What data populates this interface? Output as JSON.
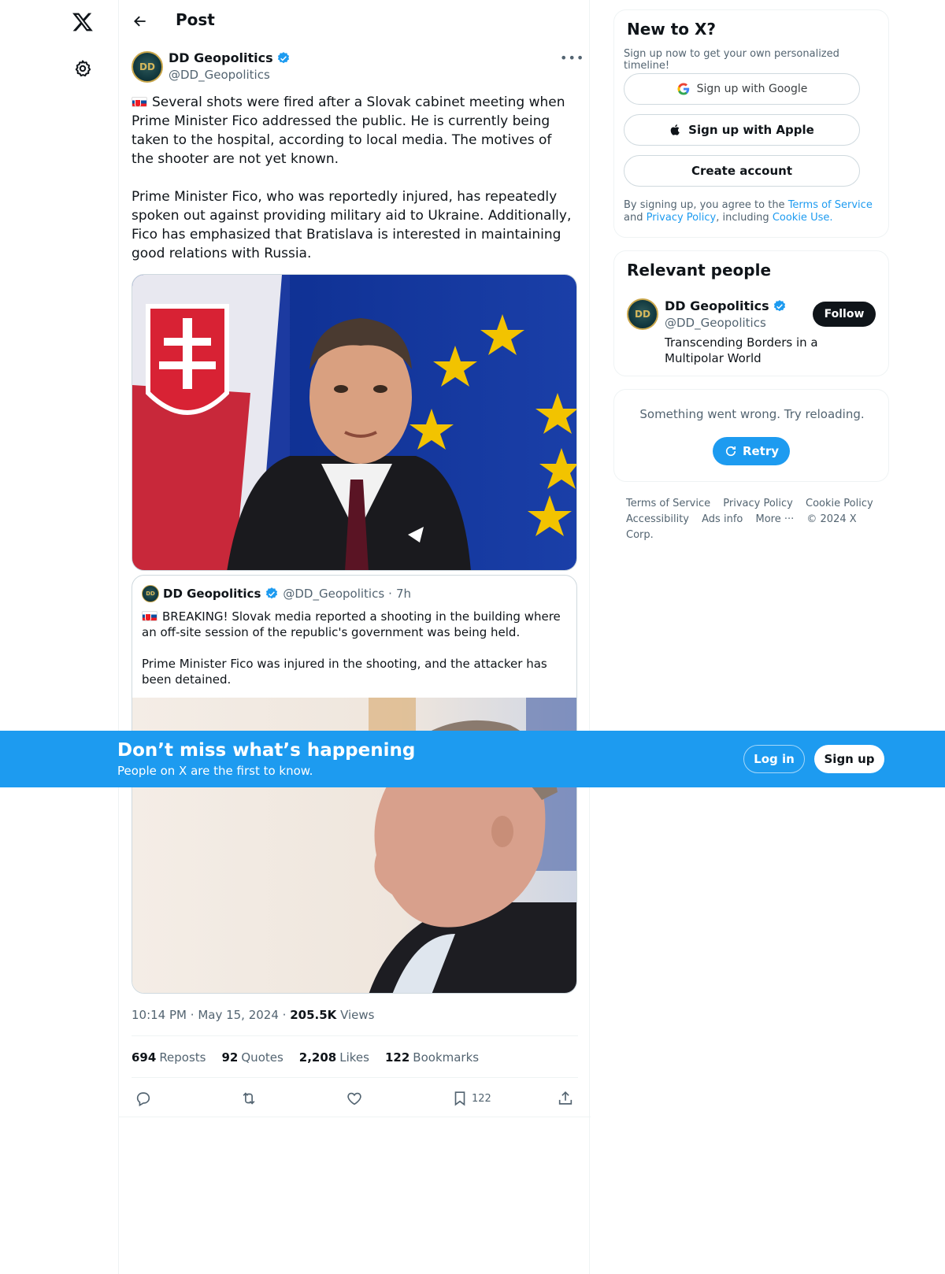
{
  "header": {
    "title": "Post"
  },
  "post": {
    "author": {
      "name": "DD Geopolitics",
      "handle": "@DD_Geopolitics",
      "avatar_text": "DD"
    },
    "paragraphs": [
      "Several shots were fired after a Slovak cabinet meeting when Prime Minister Fico addressed the public. He is currently being taken to the hospital, according to local media. The motives of the shooter are not yet known.",
      "Prime Minister Fico, who was reportedly injured, has repeatedly spoken out against providing military aid to Ukraine. Additionally, Fico has emphasized that Bratislava is interested in maintaining good relations with Russia."
    ],
    "quote": {
      "name": "DD Geopolitics",
      "handle": "@DD_Geopolitics",
      "time": "7h",
      "paragraphs": [
        "BREAKING! Slovak media reported a shooting in the building where an off-site session of the republic's government was being held.",
        "Prime Minister Fico was injured in the shooting, and the attacker has been detained."
      ]
    },
    "time": "10:14 PM",
    "date": "May 15, 2024",
    "views_count": "205.5K",
    "views_label": "Views",
    "stats": {
      "reposts": "694",
      "reposts_label": "Reposts",
      "quotes": "92",
      "quotes_label": "Quotes",
      "likes": "2,208",
      "likes_label": "Likes",
      "bookmarks": "122",
      "bookmarks_label": "Bookmarks"
    },
    "bookmark_action_count": "122"
  },
  "sidebar": {
    "new_to_x": {
      "title": "New to X?",
      "subtitle": "Sign up now to get your own personalized timeline!",
      "google_label": "Sign up with Google",
      "apple_label": "Sign up with Apple",
      "create_label": "Create account",
      "legal_prefix": "By signing up, you agree to the ",
      "terms_link": "Terms of Service",
      "legal_and": " and ",
      "privacy_link": "Privacy Policy",
      "legal_including": ", including ",
      "cookie_link": "Cookie Use."
    },
    "relevant_people": {
      "title": "Relevant people",
      "name": "DD Geopolitics",
      "handle": "@DD_Geopolitics",
      "bio": "Transcending Borders in a Multipolar World",
      "follow_label": "Follow"
    },
    "error": {
      "text": "Something went wrong. Try reloading.",
      "retry_label": "Retry"
    },
    "footer": {
      "terms": "Terms of Service",
      "privacy": "Privacy Policy",
      "cookie": "Cookie Policy",
      "accessibility": "Accessibility",
      "ads": "Ads info",
      "more": "More ···",
      "copyright": "© 2024 X Corp."
    }
  },
  "banner": {
    "title": "Don’t miss what’s happening",
    "subtitle": "People on X are the first to know.",
    "login_label": "Log in",
    "signup_label": "Sign up"
  },
  "colors": {
    "accent": "#1d9bf0",
    "text": "#0f1419",
    "secondary": "#536471",
    "border": "#eff3f4"
  }
}
